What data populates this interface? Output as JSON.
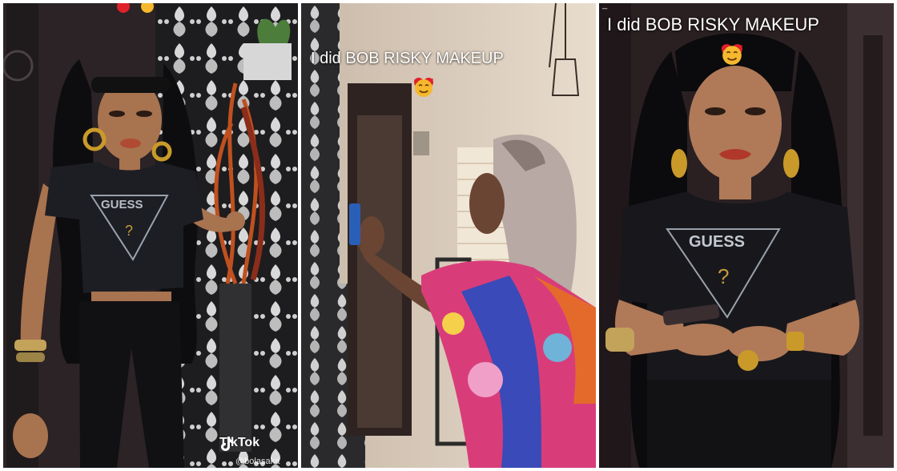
{
  "panels": [
    {
      "id": "left-panel"
    },
    {
      "id": "middle-panel",
      "caption": "I did BOB RISKY MAKEUP"
    },
    {
      "id": "right-panel",
      "caption": "I did BOB RISKY MAKEUP",
      "handle": "_"
    }
  ],
  "shirt_text": "GUESS",
  "watermark": {
    "brand": "TikTok",
    "username": "@bolasaka"
  },
  "emojis": [
    "red-heart",
    "smiling-face-with-hearts"
  ],
  "colors": {
    "caption": "#ffffff",
    "heart": "#e0202a",
    "face": "#f5b82e"
  }
}
